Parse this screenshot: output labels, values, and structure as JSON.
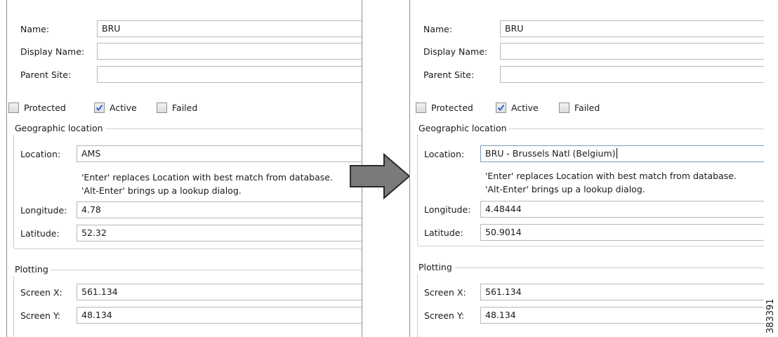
{
  "panels": [
    {
      "labels": {
        "name": "Name:",
        "display_name": "Display Name:",
        "parent_site": "Parent Site:"
      },
      "values": {
        "name": "BRU",
        "display_name": "",
        "parent_site": ""
      },
      "checkboxes": [
        {
          "label": "Protected",
          "checked": false
        },
        {
          "label": "Active",
          "checked": true
        },
        {
          "label": "Failed",
          "checked": false
        }
      ],
      "geo": {
        "title": "Geographic location",
        "location_label": "Location:",
        "location_value": "AMS",
        "hint_line1": "'Enter' replaces Location with best match from database.",
        "hint_line2": "'Alt-Enter' brings up a lookup dialog.",
        "longitude_label": "Longitude:",
        "longitude_value": "4.78",
        "latitude_label": "Latitude:",
        "latitude_value": "52.32"
      },
      "plotting": {
        "title": "Plotting",
        "screen_x_label": "Screen X:",
        "screen_x_value": "561.134",
        "screen_y_label": "Screen Y:",
        "screen_y_value": "48.134"
      }
    },
    {
      "labels": {
        "name": "Name:",
        "display_name": "Display Name:",
        "parent_site": "Parent Site:"
      },
      "values": {
        "name": "BRU",
        "display_name": "",
        "parent_site": ""
      },
      "checkboxes": [
        {
          "label": "Protected",
          "checked": false
        },
        {
          "label": "Active",
          "checked": true
        },
        {
          "label": "Failed",
          "checked": false
        }
      ],
      "geo": {
        "title": "Geographic location",
        "location_label": "Location:",
        "location_value": "BRU - Brussels Natl (Belgium)",
        "hint_line1": "'Enter' replaces Location with best match from database.",
        "hint_line2": "'Alt-Enter' brings up a lookup dialog.",
        "longitude_label": "Longitude:",
        "longitude_value": "4.48444",
        "latitude_label": "Latitude:",
        "latitude_value": "50.9014"
      },
      "plotting": {
        "title": "Plotting",
        "screen_x_label": "Screen X:",
        "screen_x_value": "561.134",
        "screen_y_label": "Screen Y:",
        "screen_y_value": "48.134"
      }
    }
  ],
  "figure_id": "383391",
  "colors": {
    "arrow_fill": "#7a7a7a",
    "arrow_stroke": "#2a2a2a",
    "check": "#2a5bd7"
  }
}
